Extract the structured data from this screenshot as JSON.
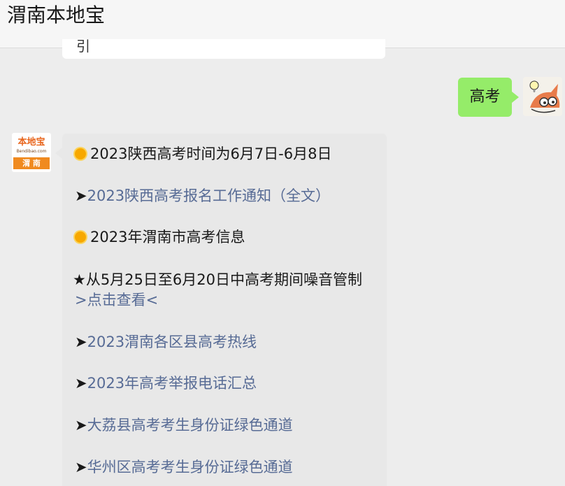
{
  "header": {
    "title": "渭南本地宝"
  },
  "previous": {
    "fragment": "引"
  },
  "outgoing": {
    "text": "高考"
  },
  "bot": {
    "brand": "本地宝",
    "domain": "Bendibao.com",
    "city": "渭 南"
  },
  "message": {
    "item1": "2023陕西高考时间为6月7日-6月8日",
    "arrow": "➤",
    "item2_link": "2023陕西高考报名工作通知（全文）",
    "item3": "2023年渭南市高考信息",
    "item4": "★从5月25日至6月20日中高考期间噪音管制",
    "item4_link": ">点击查看<",
    "item5_link": "2023渭南各区县高考热线",
    "item6_link": "2023年高考举报电话汇总",
    "item7_link": "大荔县高考考生身份证绿色通道",
    "item8_link": "华州区高考考生身份证绿色通道"
  },
  "colors": {
    "outgoing_bubble": "#95ec69",
    "incoming_bubble": "#e8e8e8",
    "link": "#576b95",
    "background": "#ededed"
  }
}
